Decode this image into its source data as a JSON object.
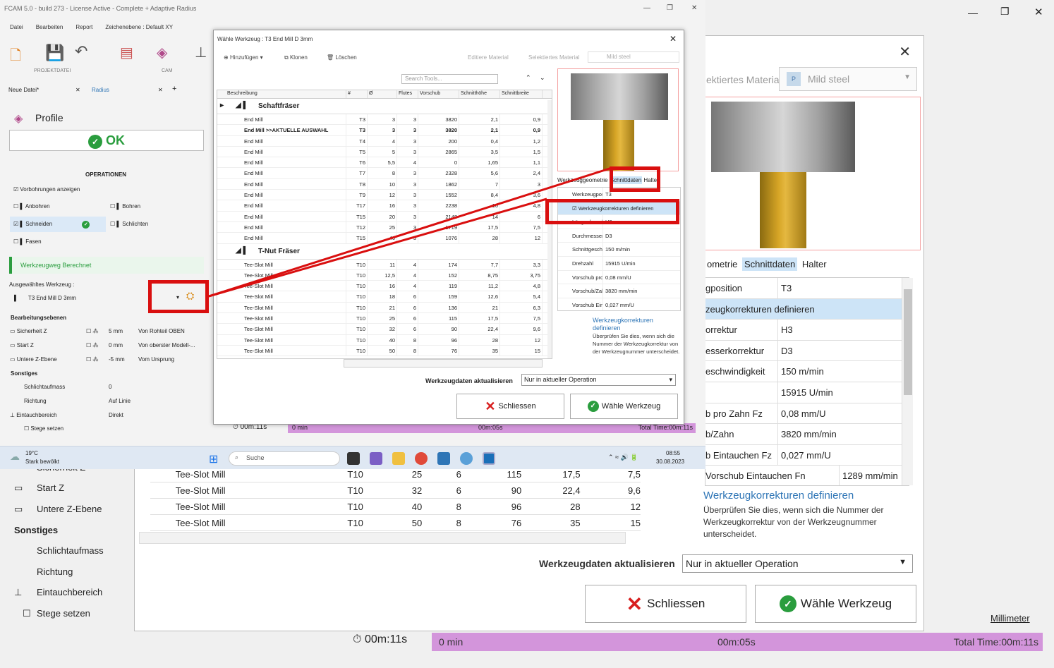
{
  "app": {
    "title": "FCAM 5.0 - build 273 - License Active - Complete + Adaptive Radius",
    "menu": [
      "Datei",
      "Bearbeiten",
      "Report",
      "Zeichenebene : Default XY"
    ],
    "ribbon_groups": [
      "PROJEKTDATEI",
      "CAM"
    ],
    "tabs": [
      "Neue Datei*",
      "Radius"
    ],
    "profile_label": "Profile",
    "ok_label": "OK",
    "operations_header": "OPERATIONEN",
    "pre_drill_label": "Vorbohrungen anzeigen",
    "ops": [
      "Anbohren",
      "Bohren",
      "Schneiden",
      "Schlichten",
      "Fasen"
    ],
    "toolpath_status": "Werkzeugweg Berechnet",
    "selected_tool_label": "Ausgewähltes Werkzeug :",
    "selected_tool": "T3 End Mill D 3mm",
    "planes_header": "Bearbeitungsebenen",
    "planes": [
      {
        "label": "Sicherheit Z",
        "value": "5 mm",
        "ref": "Von Rohteil OBEN"
      },
      {
        "label": "Start Z",
        "value": "0 mm",
        "ref": "Von oberster Modell-..."
      },
      {
        "label": "Untere Z-Ebene",
        "value": "-5 mm",
        "ref": "Vom Ursprung"
      }
    ],
    "misc_header": "Sonstiges",
    "misc": [
      {
        "label": "Schlichtaufmass",
        "value": "0"
      },
      {
        "label": "Richtung",
        "value": "Auf Linie"
      },
      {
        "label": "Eintauchbereich",
        "value": "Direkt"
      },
      {
        "label": "Stege setzen",
        "value": ""
      }
    ]
  },
  "status": {
    "time": "00m:11s",
    "start": "0 min",
    "mid": "00m:05s",
    "total": "Total Time:00m:11s",
    "units": "Millimeter"
  },
  "dialog": {
    "title": "Wähle Werkzeug : T3 End Mill D 3mm",
    "toolbar": [
      "Hinzufügen",
      "Klonen",
      "Löschen",
      "Editiere Material",
      "Selektiertes Material"
    ],
    "material": "Mild steel",
    "search_placeholder": "Search Tools...",
    "columns": [
      "Beschreibung",
      "#",
      "Ø",
      "Flutes",
      "Vorschub",
      "Schnitthöhe",
      "Schnittbreite"
    ],
    "group1": "Schaftfräser",
    "rows1": [
      [
        "End Mill",
        "T3",
        "3",
        "3",
        "3820",
        "2,1",
        "0,9"
      ],
      [
        "End Mill  >>AKTUELLE AUSWAHL",
        "T3",
        "3",
        "3",
        "3820",
        "2,1",
        "0,9"
      ],
      [
        "End Mill",
        "T4",
        "4",
        "3",
        "200",
        "0,4",
        "1,2"
      ],
      [
        "End Mill",
        "T5",
        "5",
        "3",
        "2865",
        "3,5",
        "1,5"
      ],
      [
        "End Mill",
        "T6",
        "5,5",
        "4",
        "0",
        "1,65",
        "1,1"
      ],
      [
        "End Mill",
        "T7",
        "8",
        "3",
        "2328",
        "5,6",
        "2,4"
      ],
      [
        "End Mill",
        "T8",
        "10",
        "3",
        "1862",
        "7",
        "3"
      ],
      [
        "End Mill",
        "T9",
        "12",
        "3",
        "1552",
        "8,4",
        "3,6"
      ],
      [
        "End Mill",
        "T17",
        "16",
        "3",
        "2238",
        "10",
        "4,8"
      ],
      [
        "End Mill",
        "T15",
        "20",
        "3",
        "2148",
        "14",
        "6"
      ],
      [
        "End Mill",
        "T12",
        "25",
        "3",
        "1719",
        "17,5",
        "7,5"
      ],
      [
        "End Mill",
        "T15",
        "40",
        "3",
        "1076",
        "28",
        "12"
      ]
    ],
    "group2": "T-Nut Fräser",
    "rows2": [
      [
        "Tee-Slot Mill",
        "T10",
        "11",
        "4",
        "174",
        "7,7",
        "3,3"
      ],
      [
        "Tee-Slot Mill",
        "T10",
        "12,5",
        "4",
        "152",
        "8,75",
        "3,75"
      ],
      [
        "Tee-Slot Mill",
        "T10",
        "16",
        "4",
        "119",
        "11,2",
        "4,8"
      ],
      [
        "Tee-Slot Mill",
        "T10",
        "18",
        "6",
        "159",
        "12,6",
        "5,4"
      ],
      [
        "Tee-Slot Mill",
        "T10",
        "21",
        "6",
        "136",
        "21",
        "6,3"
      ],
      [
        "Tee-Slot Mill",
        "T10",
        "25",
        "6",
        "115",
        "17,5",
        "7,5"
      ],
      [
        "Tee-Slot Mill",
        "T10",
        "32",
        "6",
        "90",
        "22,4",
        "9,6"
      ],
      [
        "Tee-Slot Mill",
        "T10",
        "40",
        "8",
        "96",
        "28",
        "12"
      ],
      [
        "Tee-Slot Mill",
        "T10",
        "50",
        "8",
        "76",
        "35",
        "15"
      ]
    ],
    "prop_tabs": [
      "Werkzeuggeometrie",
      "Schnittdaten",
      "Halter"
    ],
    "props": [
      {
        "k": "Werkzeugposition",
        "v": "T3"
      },
      {
        "k": "Werkzeugkorrekturen definieren",
        "v": ""
      },
      {
        "k": "Längenkorrektur",
        "v": "H3"
      },
      {
        "k": "Durchmesserkorrektur",
        "v": "D3"
      },
      {
        "k": "Schnittgeschwindigkeit",
        "v": "150 m/min"
      },
      {
        "k": "Drehzahl",
        "v": "15915 U/min"
      },
      {
        "k": "Vorschub pro Zahn Fz",
        "v": "0,08 mm/U"
      },
      {
        "k": "Vorschub/Zahn",
        "v": "3820 mm/min"
      },
      {
        "k": "Vorschub Eintauchen Fz",
        "v": "0,027 mm/U"
      },
      {
        "k": "Vorschub Eintauchen Fn",
        "v": "1289 mm/min"
      }
    ],
    "help_title": "Werkzeugkorrekturen definieren",
    "help_text": "Überprüfen Sie dies, wenn sich die Nummer der Werkzeugkorrektur von der Werkzeugnummer unterscheidet.",
    "update_label": "Werkzeugdaten aktualisieren",
    "update_value": "Nur in aktueller Operation",
    "close_label": "Schliessen",
    "select_label": "Wähle Werkzeug"
  },
  "bg": {
    "material_label": "Selektiertes Material",
    "tabs": [
      "Werkzeuggeometrie",
      "Schnittdaten",
      "Halter"
    ],
    "props": [
      {
        "k": "Werkzeugposition",
        "v": "T3"
      },
      {
        "k": "Werkzeugkorrekturen definieren",
        "v": ""
      },
      {
        "k": "Längenkorrektur",
        "v": "H3"
      },
      {
        "k": "Durchmesserkorrektur",
        "v": "D3"
      },
      {
        "k": "Schnittgeschwindigkeit",
        "v": "150 m/min"
      },
      {
        "k": "Drehzahl",
        "v": "15915 U/min"
      },
      {
        "k": "Vorschub pro Zahn Fz",
        "v": "0,08 mm/U"
      },
      {
        "k": "Vorschub/Zahn",
        "v": "3820 mm/min"
      },
      {
        "k": "Vorschub Eintauchen Fz",
        "v": "0,027 mm/U"
      },
      {
        "k": "Vorschub Eintauchen Fn",
        "v": "1289 mm/min"
      }
    ],
    "rows": [
      [
        "Tee-Slot Mill",
        "T10",
        "25",
        "6",
        "115",
        "17,5",
        "7,5"
      ],
      [
        "Tee-Slot Mill",
        "T10",
        "32",
        "6",
        "90",
        "22,4",
        "9,6"
      ],
      [
        "Tee-Slot Mill",
        "T10",
        "40",
        "8",
        "96",
        "28",
        "12"
      ],
      [
        "Tee-Slot Mill",
        "T10",
        "50",
        "8",
        "76",
        "35",
        "15"
      ]
    ]
  },
  "taskbar": {
    "weather_temp": "19°C",
    "weather_text": "Stark bewölkt",
    "search": "Suche",
    "time": "08:55",
    "date": "30.08.2023"
  },
  "colors": {
    "accent": "#2e75b6",
    "ok_green": "#2a9d3e",
    "highlight": "#d90f0f",
    "progress": "#d395db",
    "selection": "#cde4f7"
  }
}
